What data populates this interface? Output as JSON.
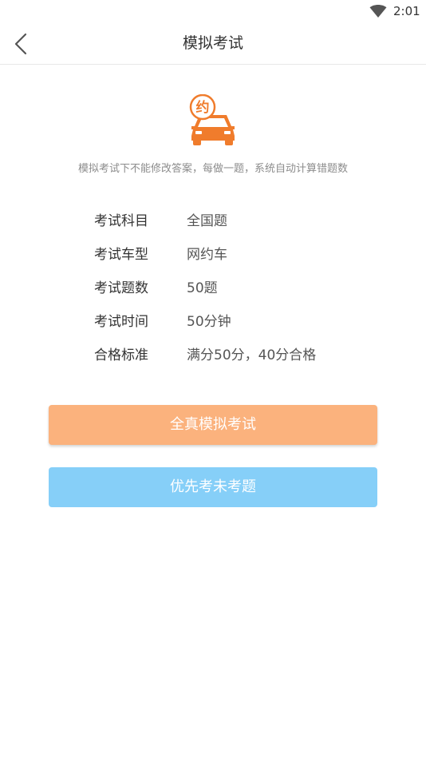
{
  "status_bar": {
    "time": "2:01",
    "wifi_icon": "wifi-icon"
  },
  "header": {
    "title": "模拟考试",
    "back_icon": "chevron-left-icon"
  },
  "logo": {
    "badge_char": "约",
    "color": "#f07c2c"
  },
  "description": "模拟考试下不能修改答案，每做一题，系统自动计算错题数",
  "exam_info": [
    {
      "label": "考试科目",
      "value": "全国题"
    },
    {
      "label": "考试车型",
      "value": "网约车"
    },
    {
      "label": "考试题数",
      "value": "50题"
    },
    {
      "label": "考试时间",
      "value": "50分钟"
    },
    {
      "label": "合格标准",
      "value": "满分50分，40分合格"
    }
  ],
  "buttons": {
    "full_exam": "全真模拟考试",
    "unanswered_first": "优先考未考题"
  },
  "colors": {
    "orange_button": "#fbb27d",
    "blue_button": "#86cff8",
    "accent": "#f07c2c"
  }
}
